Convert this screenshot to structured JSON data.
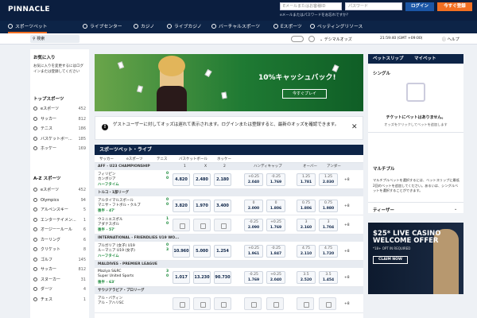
{
  "topbar": {
    "logo": "PINNACLE",
    "email_placeholder": "Eメールまたはお客様ID",
    "password_placeholder": "パスワード",
    "login": "ログイン",
    "signup": "今すぐ登録",
    "forgot": "eメールまたはパスワードをお忘れですか？"
  },
  "nav": {
    "items": [
      {
        "label": "スポーツベット",
        "icon": "soccer-ball-icon"
      },
      {
        "label": "ライブセンター",
        "icon": "play-icon"
      },
      {
        "label": "カジノ",
        "icon": "cards-icon"
      },
      {
        "label": "ライブカジノ",
        "icon": "chip-icon"
      },
      {
        "label": "バーチャルスポーツ",
        "icon": "virtual-icon"
      },
      {
        "label": "Eスポーツ",
        "icon": "controller-icon"
      },
      {
        "label": "ベッティングリソース",
        "icon": "book-icon"
      }
    ]
  },
  "subbar": {
    "search_placeholder": "検索",
    "odds_format": "デシマルオッズ",
    "time": "21:59:40 (GMT +09:00)",
    "help": "ヘルプ"
  },
  "left": {
    "favorites_title": "お気に入り",
    "favorites_text": "お気に入りを変更するにはログインまたは登録してください",
    "top_title": "トップスポーツ",
    "top": [
      {
        "label": "eスポーツ",
        "count": "452"
      },
      {
        "label": "サッカー",
        "count": "812"
      },
      {
        "label": "テニス",
        "count": "186"
      },
      {
        "label": "バスケットボー...",
        "count": "185"
      },
      {
        "label": "ホッケー",
        "count": "169"
      }
    ],
    "az_title": "A-Z スポーツ",
    "az": [
      {
        "label": "eスポーツ",
        "count": "452"
      },
      {
        "label": "Olympics",
        "count": "94"
      },
      {
        "label": "アルペンスキー",
        "count": "5"
      },
      {
        "label": "エンターテイメン...",
        "count": "1"
      },
      {
        "label": "オージーールール",
        "count": "6"
      },
      {
        "label": "カーリング",
        "count": "6"
      },
      {
        "label": "クリケット",
        "count": "8"
      },
      {
        "label": "ゴルフ",
        "count": "145"
      },
      {
        "label": "サッカー",
        "count": "812"
      },
      {
        "label": "スヌーカー",
        "count": "31"
      },
      {
        "label": "ダーツ",
        "count": "4"
      },
      {
        "label": "チェス",
        "count": "1"
      }
    ]
  },
  "banner": {
    "title": "10%キャッシュバック!",
    "cta": "今すぐプレイ"
  },
  "notice": {
    "text": "ゲストユーザーに対してオッズは遅れて表示されます。ログインまたは登録すると、最新のオッズを確認できます。",
    "login": "ログイン",
    "signup": "登録"
  },
  "live": {
    "title": "スポーツベット・ライブ",
    "tabs": [
      "サッカー",
      "eスポーツ",
      "テニス",
      "バスケットボール",
      "ホッケー"
    ],
    "col_1": "1",
    "col_x": "X",
    "col_2": "2",
    "col_hc": "ハンディキャップ",
    "col_over": "オーバー",
    "col_under": "アンダー",
    "leagues": [
      "AFF - U23 CHAMPIONSHIP",
      "トルコ・1部リーグ",
      "INTERNATIONAL - FRIENDLIES U19 WO...",
      "MALDIVES - PREMIER LEAGUE",
      "サウジアラビア・プロリーグ"
    ],
    "matches": [
      {
        "team1": "フィリピン",
        "team2": "カンボジア",
        "time": "ハーフタイム",
        "s1": "0",
        "s2": "0",
        "o1": "4.820",
        "ox": "2.480",
        "o2": "2.180",
        "h1a": "+0.25",
        "h1b": "2.040",
        "h2a": "-0.25",
        "h2b": "1.769",
        "ova": "1.25",
        "ovb": "1.781",
        "una": "1.25",
        "unb": "2.030",
        "more": "+8"
      },
      {
        "team1": "アルタイマルスポール",
        "team2": "マニサ・フトボル・クルブ",
        "time": "後半 - 47'",
        "s1": "0",
        "s2": "0",
        "o1": "3.820",
        "ox": "1.970",
        "o2": "3.400",
        "h1a": "0",
        "h1b": "2.000",
        "h2a": "0",
        "h2b": "1.806",
        "ova": "0.75",
        "ovb": "1.806",
        "una": "0.75",
        "unb": "1.980",
        "more": "+8"
      },
      {
        "team1": "ウミニエスポル",
        "team2": "アダナスポル",
        "time": "後半 - 57'",
        "s1": "1",
        "s2": "0",
        "o1": "",
        "ox": "",
        "o2": "",
        "h1a": "-0.25",
        "h1b": "2.090",
        "h2a": "+0.25",
        "h2b": "1.769",
        "ova": "3",
        "ovb": "2.160",
        "una": "3",
        "unb": "1.704",
        "more": "+8"
      },
      {
        "team1": "ブルガリア (女子) U19",
        "team2": "ルーマニア U19 (女子)",
        "time": "ハーフタイム",
        "s1": "0",
        "s2": "3",
        "o1": "10.960",
        "ox": "5.000",
        "o2": "1.254",
        "h1a": "+0.25",
        "h1b": "1.961",
        "h2a": "-0.25",
        "h2b": "1.847",
        "ova": "4.75",
        "ovb": "2.110",
        "una": "4.75",
        "unb": "1.720",
        "more": "+8"
      },
      {
        "team1": "Maziya S&RC",
        "team2": "Super United Sports",
        "time": "後半 - 63'",
        "s1": "3",
        "s2": "0",
        "o1": "1.017",
        "ox": "13.230",
        "o2": "90.730",
        "h1a": "-0.25",
        "h1b": "1.769",
        "h2a": "+0.25",
        "h2b": "2.040",
        "ova": "3.5",
        "ovb": "2.520",
        "una": "3.5",
        "unb": "1.454",
        "more": "+8"
      },
      {
        "team1": "アル・バティン",
        "team2": "アル・アハリSC",
        "time": "",
        "s1": "",
        "s2": "",
        "o1": "",
        "ox": "",
        "o2": "",
        "h1a": "",
        "h1b": "",
        "h2a": "",
        "h2b": "",
        "ova": "",
        "ovb": "",
        "una": "",
        "unb": "",
        "more": "+8"
      }
    ]
  },
  "betslip": {
    "tab1": "ベットスリップ",
    "tab2": "マイベット",
    "single": "シングル",
    "empty_title": "チケットにベットはありません。",
    "empty_text": "オッズをクリックしてベットを追加します",
    "multiple": "マルチプル",
    "multiple_text": "マルチプルベットを選択するには、ベットスリップに最低2回のベットを追加してください。あるいは、シングルベットを選択することができます。",
    "teaser": "ティーザー"
  },
  "promo": {
    "title1": "$25* LIVE CASINO",
    "title2": "WELCOME OFFER",
    "sub": "*18+ OPT IN REQUIRED",
    "cta": "CLAIM NOW"
  },
  "colors": {
    "navy": "#0b1e3f",
    "orange": "#f26f22",
    "blue": "#1b56a6",
    "green": "#1a8a3a"
  }
}
